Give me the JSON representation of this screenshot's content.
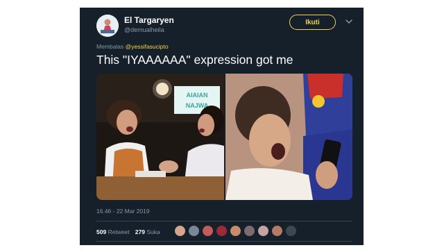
{
  "tweet": {
    "author_name": "El Targaryen",
    "author_handle": "@demualheila",
    "follow_label": "Ikuti",
    "reply_prefix": "Membalas",
    "reply_to": "@yessifasucipto",
    "text": "This \"IYAAAAAA\" expression got me",
    "media_sign_text": [
      "AIAIAN",
      "NAJWA"
    ],
    "timestamp": "16.46 - 22 Mar 2019"
  },
  "stats": {
    "retweets_count": "509",
    "retweets_label": "Retweet",
    "likes_count": "279",
    "likes_label": "Suka"
  },
  "likers": [
    {
      "icon": "avatar-1",
      "color": "#d6a58c"
    },
    {
      "icon": "avatar-2",
      "color": "#7b8796"
    },
    {
      "icon": "avatar-3",
      "color": "#c45b5b"
    },
    {
      "icon": "avatar-4",
      "color": "#9c2a3a"
    },
    {
      "icon": "avatar-5",
      "color": "#c98b6c"
    },
    {
      "icon": "avatar-6",
      "color": "#7d6a72"
    },
    {
      "icon": "avatar-7",
      "color": "#c4a4a0"
    },
    {
      "icon": "avatar-8",
      "color": "#b47a66"
    },
    {
      "icon": "avatar-9",
      "color": "#3e4850"
    }
  ],
  "colors": {
    "background": "#15202b",
    "accent": "#f5d24a",
    "secondary_text": "#8899a6",
    "divider": "#38444d"
  }
}
